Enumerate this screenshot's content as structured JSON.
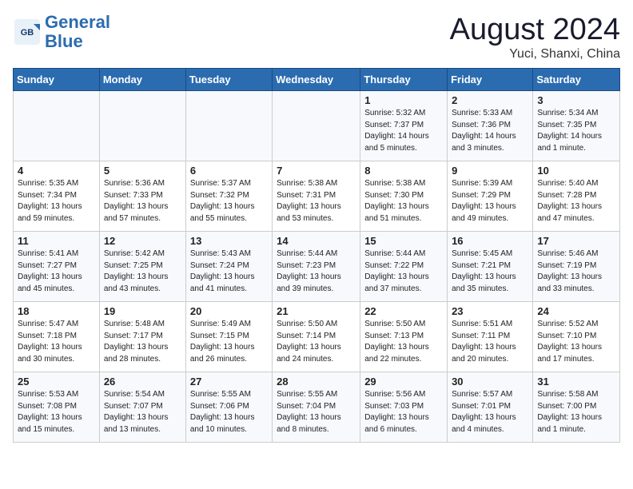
{
  "header": {
    "logo_line1": "General",
    "logo_line2": "Blue",
    "month_year": "August 2024",
    "location": "Yuci, Shanxi, China"
  },
  "weekdays": [
    "Sunday",
    "Monday",
    "Tuesday",
    "Wednesday",
    "Thursday",
    "Friday",
    "Saturday"
  ],
  "weeks": [
    [
      {
        "day": "",
        "info": ""
      },
      {
        "day": "",
        "info": ""
      },
      {
        "day": "",
        "info": ""
      },
      {
        "day": "",
        "info": ""
      },
      {
        "day": "1",
        "info": "Sunrise: 5:32 AM\nSunset: 7:37 PM\nDaylight: 14 hours\nand 5 minutes."
      },
      {
        "day": "2",
        "info": "Sunrise: 5:33 AM\nSunset: 7:36 PM\nDaylight: 14 hours\nand 3 minutes."
      },
      {
        "day": "3",
        "info": "Sunrise: 5:34 AM\nSunset: 7:35 PM\nDaylight: 14 hours\nand 1 minute."
      }
    ],
    [
      {
        "day": "4",
        "info": "Sunrise: 5:35 AM\nSunset: 7:34 PM\nDaylight: 13 hours\nand 59 minutes."
      },
      {
        "day": "5",
        "info": "Sunrise: 5:36 AM\nSunset: 7:33 PM\nDaylight: 13 hours\nand 57 minutes."
      },
      {
        "day": "6",
        "info": "Sunrise: 5:37 AM\nSunset: 7:32 PM\nDaylight: 13 hours\nand 55 minutes."
      },
      {
        "day": "7",
        "info": "Sunrise: 5:38 AM\nSunset: 7:31 PM\nDaylight: 13 hours\nand 53 minutes."
      },
      {
        "day": "8",
        "info": "Sunrise: 5:38 AM\nSunset: 7:30 PM\nDaylight: 13 hours\nand 51 minutes."
      },
      {
        "day": "9",
        "info": "Sunrise: 5:39 AM\nSunset: 7:29 PM\nDaylight: 13 hours\nand 49 minutes."
      },
      {
        "day": "10",
        "info": "Sunrise: 5:40 AM\nSunset: 7:28 PM\nDaylight: 13 hours\nand 47 minutes."
      }
    ],
    [
      {
        "day": "11",
        "info": "Sunrise: 5:41 AM\nSunset: 7:27 PM\nDaylight: 13 hours\nand 45 minutes."
      },
      {
        "day": "12",
        "info": "Sunrise: 5:42 AM\nSunset: 7:25 PM\nDaylight: 13 hours\nand 43 minutes."
      },
      {
        "day": "13",
        "info": "Sunrise: 5:43 AM\nSunset: 7:24 PM\nDaylight: 13 hours\nand 41 minutes."
      },
      {
        "day": "14",
        "info": "Sunrise: 5:44 AM\nSunset: 7:23 PM\nDaylight: 13 hours\nand 39 minutes."
      },
      {
        "day": "15",
        "info": "Sunrise: 5:44 AM\nSunset: 7:22 PM\nDaylight: 13 hours\nand 37 minutes."
      },
      {
        "day": "16",
        "info": "Sunrise: 5:45 AM\nSunset: 7:21 PM\nDaylight: 13 hours\nand 35 minutes."
      },
      {
        "day": "17",
        "info": "Sunrise: 5:46 AM\nSunset: 7:19 PM\nDaylight: 13 hours\nand 33 minutes."
      }
    ],
    [
      {
        "day": "18",
        "info": "Sunrise: 5:47 AM\nSunset: 7:18 PM\nDaylight: 13 hours\nand 30 minutes."
      },
      {
        "day": "19",
        "info": "Sunrise: 5:48 AM\nSunset: 7:17 PM\nDaylight: 13 hours\nand 28 minutes."
      },
      {
        "day": "20",
        "info": "Sunrise: 5:49 AM\nSunset: 7:15 PM\nDaylight: 13 hours\nand 26 minutes."
      },
      {
        "day": "21",
        "info": "Sunrise: 5:50 AM\nSunset: 7:14 PM\nDaylight: 13 hours\nand 24 minutes."
      },
      {
        "day": "22",
        "info": "Sunrise: 5:50 AM\nSunset: 7:13 PM\nDaylight: 13 hours\nand 22 minutes."
      },
      {
        "day": "23",
        "info": "Sunrise: 5:51 AM\nSunset: 7:11 PM\nDaylight: 13 hours\nand 20 minutes."
      },
      {
        "day": "24",
        "info": "Sunrise: 5:52 AM\nSunset: 7:10 PM\nDaylight: 13 hours\nand 17 minutes."
      }
    ],
    [
      {
        "day": "25",
        "info": "Sunrise: 5:53 AM\nSunset: 7:08 PM\nDaylight: 13 hours\nand 15 minutes."
      },
      {
        "day": "26",
        "info": "Sunrise: 5:54 AM\nSunset: 7:07 PM\nDaylight: 13 hours\nand 13 minutes."
      },
      {
        "day": "27",
        "info": "Sunrise: 5:55 AM\nSunset: 7:06 PM\nDaylight: 13 hours\nand 10 minutes."
      },
      {
        "day": "28",
        "info": "Sunrise: 5:55 AM\nSunset: 7:04 PM\nDaylight: 13 hours\nand 8 minutes."
      },
      {
        "day": "29",
        "info": "Sunrise: 5:56 AM\nSunset: 7:03 PM\nDaylight: 13 hours\nand 6 minutes."
      },
      {
        "day": "30",
        "info": "Sunrise: 5:57 AM\nSunset: 7:01 PM\nDaylight: 13 hours\nand 4 minutes."
      },
      {
        "day": "31",
        "info": "Sunrise: 5:58 AM\nSunset: 7:00 PM\nDaylight: 13 hours\nand 1 minute."
      }
    ]
  ]
}
